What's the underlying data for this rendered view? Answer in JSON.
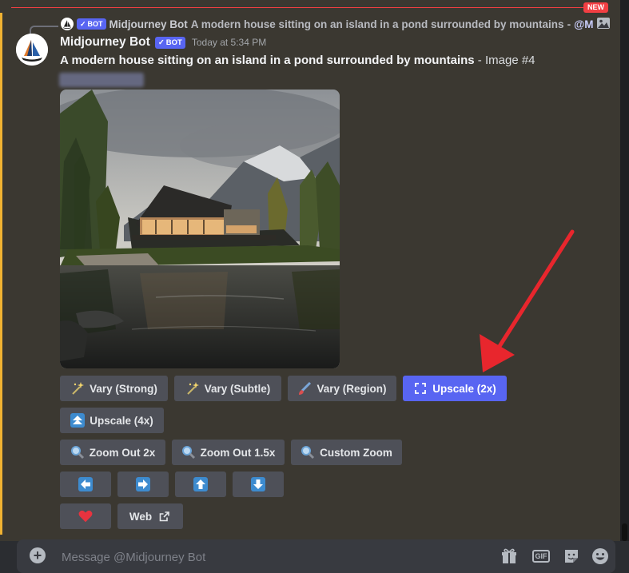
{
  "new_badge": "NEW",
  "reply": {
    "bot_tag": "BOT",
    "username": "Midjourney Bot",
    "text": "A modern house sitting on an island in a pond surrounded by mountains",
    "suffix": " - ",
    "mention": "@M"
  },
  "message": {
    "username": "Midjourney Bot",
    "bot_tag": "BOT",
    "timestamp": "Today at 5:34 PM",
    "prompt": "A modern house sitting on an island in a pond surrounded by mountains",
    "suffix": " - Image #4"
  },
  "buttons": {
    "vary_strong": "Vary (Strong)",
    "vary_subtle": "Vary (Subtle)",
    "vary_region": "Vary (Region)",
    "upscale_2x": "Upscale (2x)",
    "upscale_4x": "Upscale (4x)",
    "zoom_out_2x": "Zoom Out 2x",
    "zoom_out_1_5x": "Zoom Out 1.5x",
    "custom_zoom": "Custom Zoom",
    "web": "Web"
  },
  "composer": {
    "placeholder": "Message @Midjourney Bot",
    "gif_label": "GIF"
  },
  "colors": {
    "background": "#3b3831",
    "blurple": "#5865f2",
    "button_gray": "#4e5058",
    "annotation_arrow": "#e8262d",
    "mention_bar": "#f0b232"
  },
  "icons": [
    "sparkles-icon",
    "paintbrush-icon",
    "expand-icon",
    "up-double-icon",
    "magnifier-icon",
    "arrow-left-icon",
    "arrow-right-icon",
    "arrow-up-icon",
    "arrow-down-icon",
    "heart-icon",
    "external-link-icon",
    "plus-circle-icon",
    "gift-icon",
    "gif-icon",
    "sticker-icon",
    "emoji-icon",
    "image-icon"
  ]
}
